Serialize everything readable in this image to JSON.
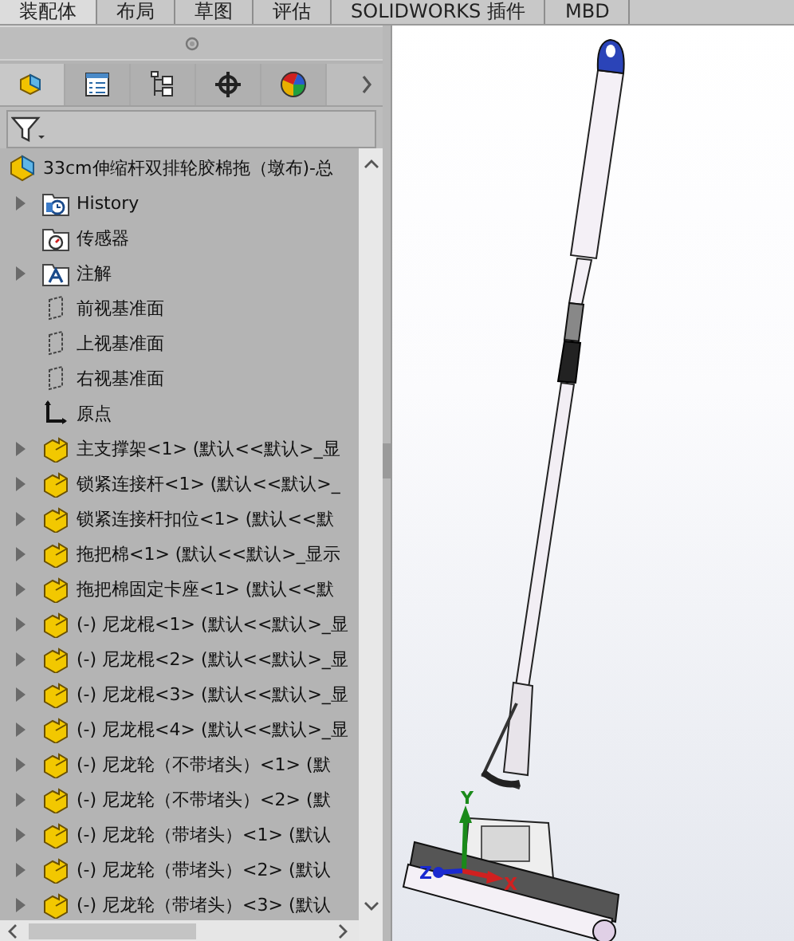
{
  "ribbon_tabs": [
    {
      "label": "装配体",
      "selected": true
    },
    {
      "label": "布局",
      "selected": false
    },
    {
      "label": "草图",
      "selected": false
    },
    {
      "label": "评估",
      "selected": false
    },
    {
      "label": "SOLIDWORKS 插件",
      "selected": false
    },
    {
      "label": "MBD",
      "selected": false
    }
  ],
  "panel_tabs": [
    {
      "kind": "assembly",
      "selected": true
    },
    {
      "kind": "properties",
      "selected": false
    },
    {
      "kind": "configurations",
      "selected": false
    },
    {
      "kind": "dimxpert",
      "selected": false
    },
    {
      "kind": "display",
      "selected": false
    }
  ],
  "tree": {
    "root": {
      "label": "33cm伸缩杆双排轮胶棉拖（墩布)-总"
    },
    "items": [
      {
        "kind": "history",
        "label": "History",
        "expandable": true
      },
      {
        "kind": "sensor",
        "label": "传感器",
        "expandable": false
      },
      {
        "kind": "annotation",
        "label": "注解",
        "expandable": true
      },
      {
        "kind": "plane",
        "label": "前视基准面",
        "expandable": false
      },
      {
        "kind": "plane",
        "label": "上视基准面",
        "expandable": false
      },
      {
        "kind": "plane",
        "label": "右视基准面",
        "expandable": false
      },
      {
        "kind": "origin",
        "label": "原点",
        "expandable": false
      },
      {
        "kind": "part",
        "label": "主支撑架<1> (默认<<默认>_显",
        "expandable": true
      },
      {
        "kind": "part",
        "label": "锁紧连接杆<1> (默认<<默认>_",
        "expandable": true
      },
      {
        "kind": "part",
        "label": "锁紧连接杆扣位<1> (默认<<默",
        "expandable": true
      },
      {
        "kind": "part",
        "label": "拖把棉<1> (默认<<默认>_显示",
        "expandable": true
      },
      {
        "kind": "part",
        "label": "拖把棉固定卡座<1> (默认<<默",
        "expandable": true
      },
      {
        "kind": "part",
        "label": "(-) 尼龙棍<1> (默认<<默认>_显",
        "expandable": true
      },
      {
        "kind": "part",
        "label": "(-) 尼龙棍<2> (默认<<默认>_显",
        "expandable": true
      },
      {
        "kind": "part",
        "label": "(-) 尼龙棍<3> (默认<<默认>_显",
        "expandable": true
      },
      {
        "kind": "part",
        "label": "(-) 尼龙棍<4> (默认<<默认>_显",
        "expandable": true
      },
      {
        "kind": "part",
        "label": "(-) 尼龙轮（不带堵头）<1> (默",
        "expandable": true
      },
      {
        "kind": "part",
        "label": "(-) 尼龙轮（不带堵头）<2> (默",
        "expandable": true
      },
      {
        "kind": "part",
        "label": "(-) 尼龙轮（带堵头）<1> (默认",
        "expandable": true
      },
      {
        "kind": "part",
        "label": "(-) 尼龙轮（带堵头）<2> (默认",
        "expandable": true
      },
      {
        "kind": "part",
        "label": "(-) 尼龙轮（带堵头）<3> (默认",
        "expandable": true
      }
    ]
  },
  "triad": {
    "x": "X",
    "y": "Y",
    "z": "Z"
  }
}
